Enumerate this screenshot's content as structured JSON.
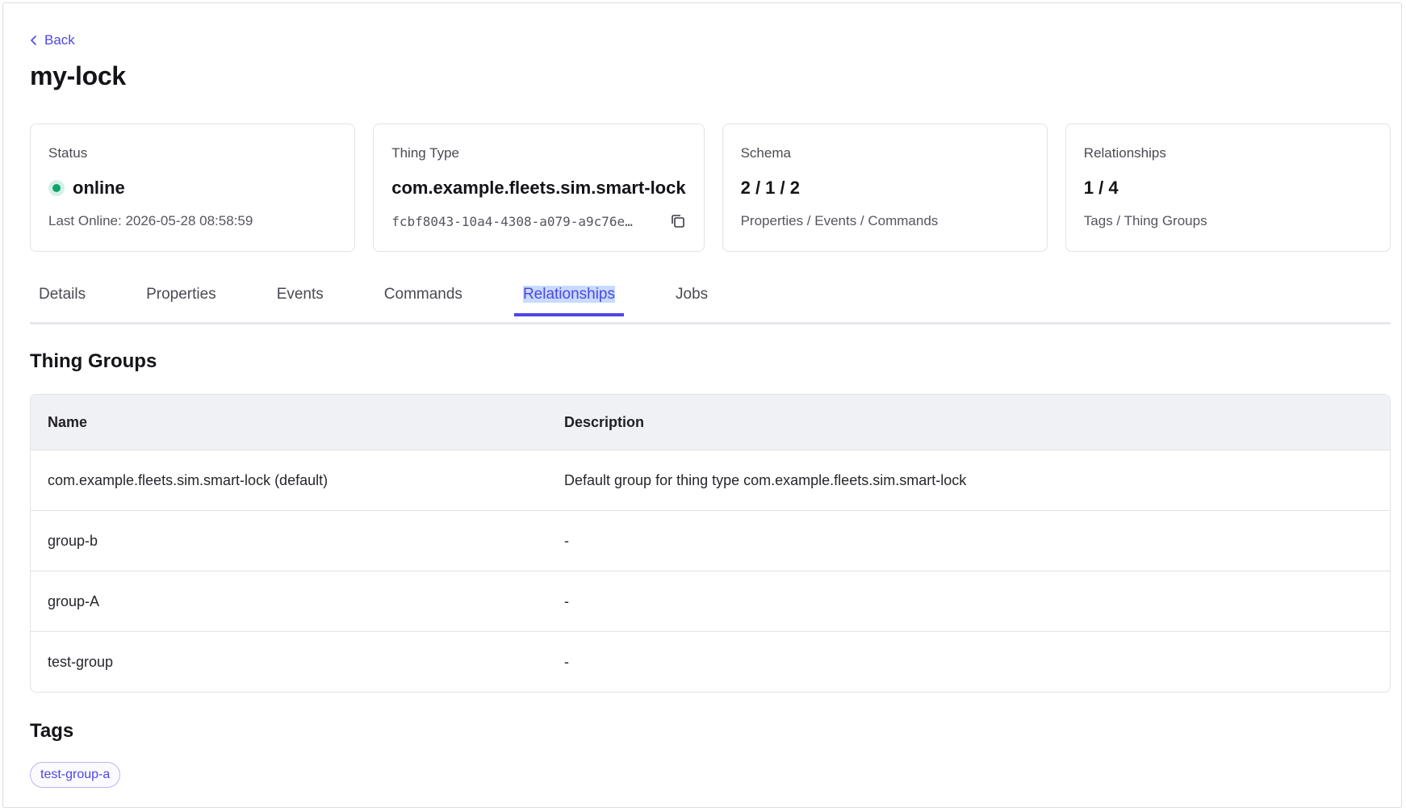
{
  "back_label": "Back",
  "page_title": "my-lock",
  "cards": {
    "status": {
      "label": "Status",
      "value": "online",
      "sub": "Last Online: 2026-05-28 08:58:59"
    },
    "thing_type": {
      "label": "Thing Type",
      "value": "com.example.fleets.sim.smart-lock",
      "id": "fcbf8043-10a4-4308-a079-a9c76e…"
    },
    "schema": {
      "label": "Schema",
      "value": "2 / 1 / 2",
      "sub": "Properties / Events / Commands"
    },
    "relationships": {
      "label": "Relationships",
      "value": "1 / 4",
      "sub": "Tags / Thing Groups"
    }
  },
  "tabs": [
    {
      "label": "Details"
    },
    {
      "label": "Properties"
    },
    {
      "label": "Events"
    },
    {
      "label": "Commands"
    },
    {
      "label": "Relationships"
    },
    {
      "label": "Jobs"
    }
  ],
  "thing_groups": {
    "title": "Thing Groups",
    "columns": [
      "Name",
      "Description"
    ],
    "rows": [
      {
        "name": "com.example.fleets.sim.smart-lock (default)",
        "description": "Default group for thing type com.example.fleets.sim.smart-lock"
      },
      {
        "name": "group-b",
        "description": "-"
      },
      {
        "name": "group-A",
        "description": "-"
      },
      {
        "name": "test-group",
        "description": "-"
      }
    ]
  },
  "tags": {
    "title": "Tags",
    "items": [
      "test-group-a"
    ]
  },
  "colors": {
    "accent": "#4f46e5",
    "status_online": "#10a36b"
  },
  "icons": {
    "back": "chevron-left-icon",
    "copy": "copy-icon",
    "status": "status-dot-icon"
  }
}
